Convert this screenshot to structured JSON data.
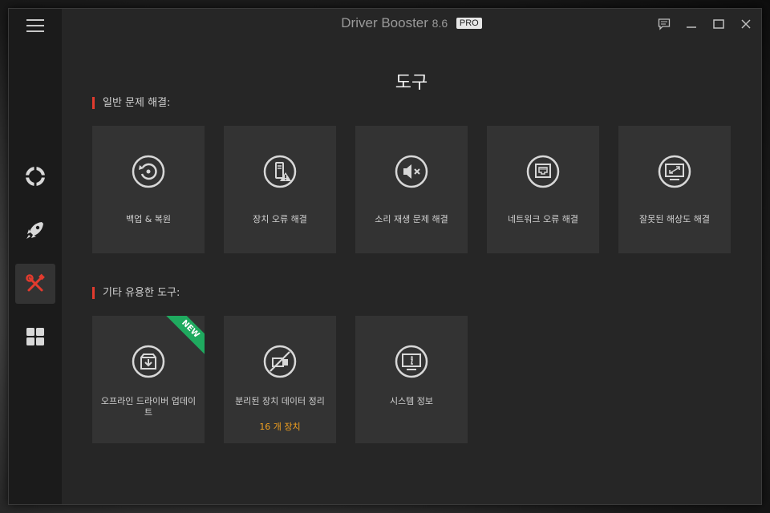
{
  "app": {
    "name": "Driver Booster",
    "version": "8.6",
    "badge": "PRO"
  },
  "page_title": "도구",
  "sections": {
    "general": {
      "label": "일반 문제 해결:"
    },
    "other": {
      "label": "기타 유용한 도구:"
    }
  },
  "general_tools": [
    {
      "label": "백업 & 복원",
      "icon": "backup-restore-icon"
    },
    {
      "label": "장치 오류 해결",
      "icon": "device-error-icon"
    },
    {
      "label": "소리 재생 문제 해결",
      "icon": "sound-mute-icon"
    },
    {
      "label": "네트워크 오류 해결",
      "icon": "network-icon"
    },
    {
      "label": "잘못된 해상도 해결",
      "icon": "resolution-icon"
    }
  ],
  "other_tools": [
    {
      "label": "오프라인 드라이버 업데이트",
      "icon": "offline-update-icon",
      "ribbon": "NEW"
    },
    {
      "label": "분리된 장치 데이터 정리",
      "icon": "disconnected-device-icon",
      "sub": "16 개 장치"
    },
    {
      "label": "시스템 정보",
      "icon": "system-info-icon"
    }
  ],
  "sidebar": [
    "support-icon",
    "boost-icon",
    "tools-icon",
    "apps-icon"
  ],
  "colors": {
    "accent": "#e23b2e",
    "highlight": "#f0a020",
    "ribbon": "#1faa5f"
  }
}
